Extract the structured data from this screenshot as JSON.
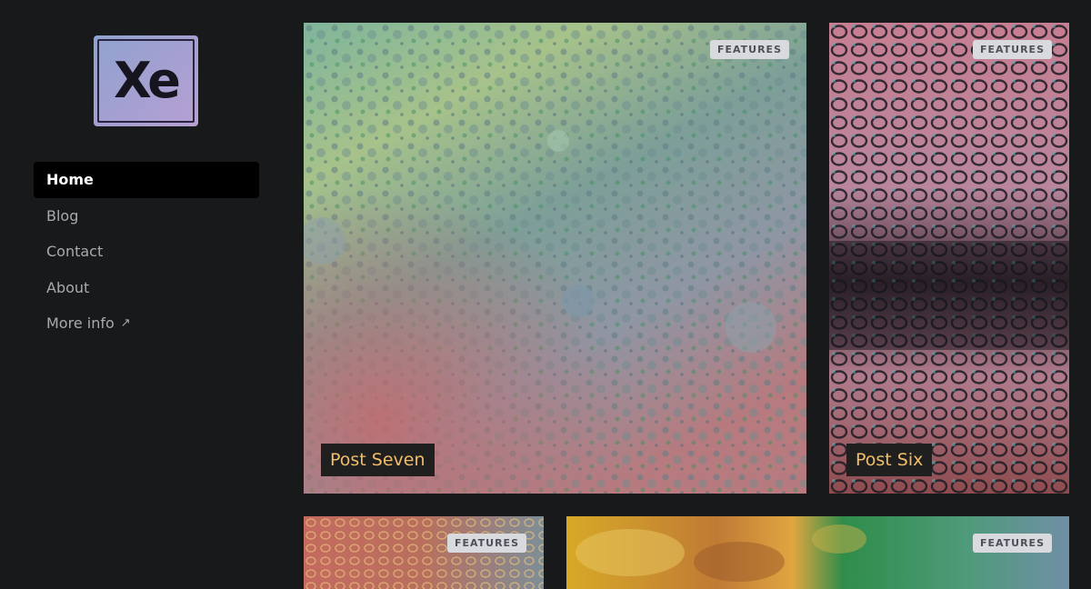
{
  "logo": {
    "text": "Xe"
  },
  "nav": {
    "items": [
      {
        "label": "Home",
        "active": true
      },
      {
        "label": "Blog"
      },
      {
        "label": "Contact"
      },
      {
        "label": "About"
      },
      {
        "label": "More info",
        "external": true
      }
    ],
    "external_icon": "↗"
  },
  "posts": [
    {
      "title": "Post Seven",
      "tag": "FEATURES"
    },
    {
      "title": "Post Six",
      "tag": "FEATURES"
    },
    {
      "title": "",
      "tag": "FEATURES"
    },
    {
      "title": "",
      "tag": "FEATURES"
    }
  ],
  "colors": {
    "background": "#18191b",
    "nav_active_bg": "#000000",
    "title_text": "#f2bd69",
    "badge_bg": "#d9dade"
  }
}
